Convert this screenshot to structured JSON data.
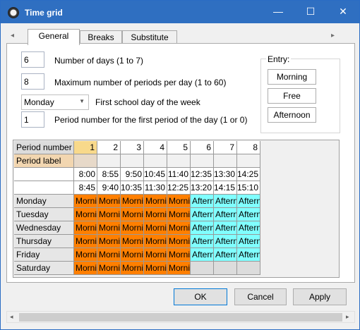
{
  "window": {
    "title": "Time grid",
    "minimize": "—",
    "maximize": "☐",
    "close": "✕"
  },
  "tabs": [
    {
      "label": "General",
      "active": true
    },
    {
      "label": "Breaks",
      "active": false
    },
    {
      "label": "Substitute",
      "active": false
    }
  ],
  "fields": {
    "num_days": {
      "value": "6",
      "label": "Number of days (1 to 7)"
    },
    "max_periods": {
      "value": "8",
      "label": "Maximum number of periods per day (1 to 60)"
    },
    "first_day": {
      "value": "Monday",
      "label": "First school day of the week"
    },
    "first_period": {
      "value": "1",
      "label": "Period number for the first period of the day (1 or 0)"
    }
  },
  "entry": {
    "caption": "Entry:",
    "buttons": [
      "Morning",
      "Free",
      "Afternoon"
    ]
  },
  "grid": {
    "period_number_label": "Period number",
    "period_label_label": "Period label",
    "periods": [
      "1",
      "2",
      "3",
      "4",
      "5",
      "6",
      "7",
      "8"
    ],
    "start_times": [
      "8:00",
      "8:55",
      "9:50",
      "10:45",
      "11:40",
      "12:35",
      "13:30",
      "14:25"
    ],
    "end_times": [
      "8:45",
      "9:40",
      "10:35",
      "11:30",
      "12:25",
      "13:20",
      "14:15",
      "15:10"
    ],
    "days": [
      {
        "name": "Monday",
        "cells": [
          "Morni",
          "Morni",
          "Morni",
          "Morni",
          "Morni",
          "Aftern",
          "Aftern",
          "Aftern"
        ]
      },
      {
        "name": "Tuesday",
        "cells": [
          "Morni",
          "Morni",
          "Morni",
          "Morni",
          "Morni",
          "Aftern",
          "Aftern",
          "Aftern"
        ]
      },
      {
        "name": "Wednesday",
        "cells": [
          "Morni",
          "Morni",
          "Morni",
          "Morni",
          "Morni",
          "Aftern",
          "Aftern",
          "Aftern"
        ]
      },
      {
        "name": "Thursday",
        "cells": [
          "Morni",
          "Morni",
          "Morni",
          "Morni",
          "Morni",
          "Aftern",
          "Aftern",
          "Aftern"
        ]
      },
      {
        "name": "Friday",
        "cells": [
          "Morni",
          "Morni",
          "Morni",
          "Morni",
          "Morni",
          "Aftern",
          "Aftern",
          "Aftern"
        ]
      },
      {
        "name": "Saturday",
        "cells": [
          "Morni",
          "Morni",
          "Morni",
          "Morni",
          "Morni",
          "",
          "",
          ""
        ]
      }
    ],
    "colors": {
      "morning": "#ff7f00",
      "afternoon": "#80ffff",
      "empty": "#dcdcdc"
    }
  },
  "buttons": {
    "ok": "OK",
    "cancel": "Cancel",
    "apply": "Apply"
  },
  "icons": {
    "app": "clock-icon",
    "tab_left": "◂",
    "tab_right": "▸",
    "combo": "▼"
  }
}
